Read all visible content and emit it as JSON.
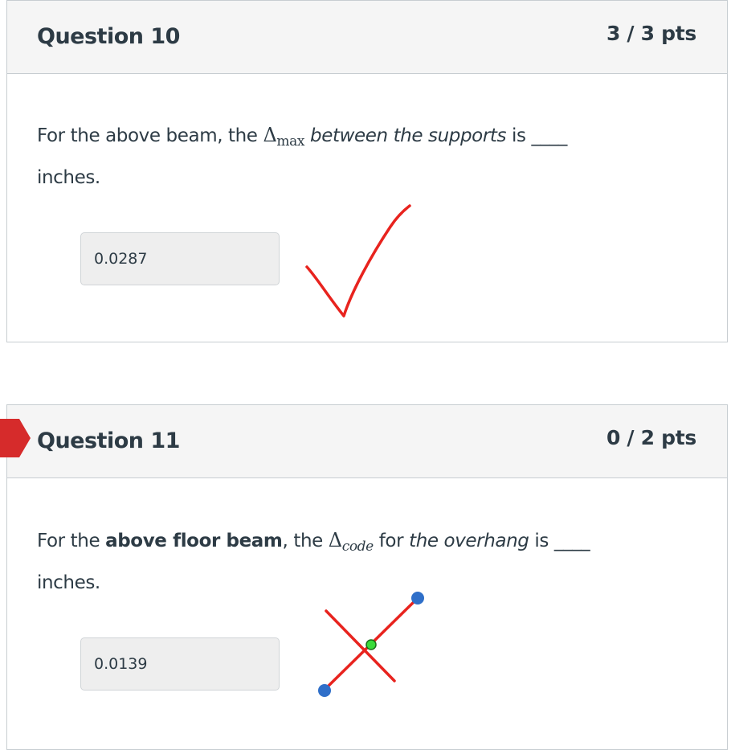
{
  "q10": {
    "title": "Question 10",
    "points": "3 / 3 pts",
    "text": {
      "pre": "For the above beam, the ",
      "delta": "Δ",
      "sub": "max",
      "italic": "between the supports",
      "post": " is ____",
      "line2": "inches."
    },
    "answer": "0.0287",
    "mark": "checkmark-icon"
  },
  "q11": {
    "title": "Question 11",
    "points": "0 / 2 pts",
    "text": {
      "pre": "For the ",
      "bold": "above floor beam",
      "mid": ", the ",
      "delta": "Δ",
      "sub": "code",
      "mid2": " for ",
      "italic": "the overhang",
      "post": " is ____",
      "line2": "inches."
    },
    "answer": "0.0139",
    "mark": "cross-icon",
    "flag": "incorrect-flag-icon"
  },
  "colors": {
    "mark": "#e8231e",
    "flag": "#d62b2b",
    "handle": "#2f6fc9",
    "center_handle": "#3adb3a"
  }
}
